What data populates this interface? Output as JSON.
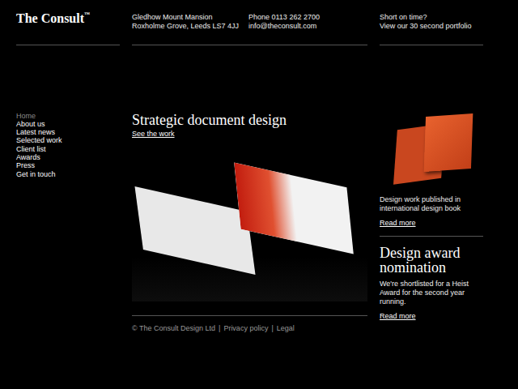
{
  "logo": {
    "name": "The Consult",
    "mark": "™"
  },
  "address": [
    "Gledhow Mount Mansion",
    "Roxholme Grove, Leeds LS7 4JJ"
  ],
  "contact": [
    "Phone 0113 262 2700",
    "info@theconsult.com"
  ],
  "shortcut": [
    "Short on time?",
    "View our 30 second portfolio"
  ],
  "nav": [
    {
      "label": "Home",
      "selected": true
    },
    {
      "label": "About us",
      "selected": false
    },
    {
      "label": "Latest news",
      "selected": false
    },
    {
      "label": "Selected work",
      "selected": false
    },
    {
      "label": "Client list",
      "selected": false
    },
    {
      "label": "Awards",
      "selected": false
    },
    {
      "label": "Press",
      "selected": false
    },
    {
      "label": "Get in touch",
      "selected": false
    }
  ],
  "feature": {
    "title": "Strategic document design",
    "link": "See the work"
  },
  "footer": {
    "items": [
      "© The Consult Design Ltd",
      "Privacy policy",
      "Legal"
    ],
    "separator": "|"
  },
  "sidebar": [
    {
      "kind": "image",
      "title": "",
      "text": "Design work published in international design book",
      "link": "Read more"
    },
    {
      "kind": "heading",
      "title": "Design award nomination",
      "text": "We're shortlisted for a Heist Award for the second year running.",
      "link": "Read more"
    }
  ]
}
